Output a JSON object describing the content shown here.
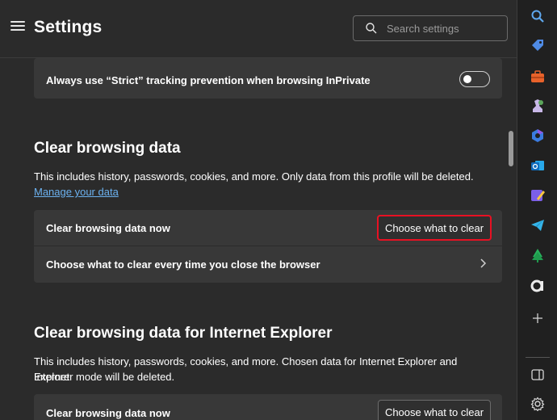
{
  "header": {
    "title": "Settings",
    "search_placeholder": "Search settings"
  },
  "tracking": {
    "label": "Always use “Strict” tracking prevention when browsing InPrivate",
    "toggle_on": false
  },
  "clear_section": {
    "title": "Clear browsing data",
    "description": "This includes history, passwords, cookies, and more. Only data from this profile will be deleted.",
    "manage_link": "Manage your data",
    "row_now_label": "Clear browsing data now",
    "row_now_button": "Choose what to clear",
    "row_close_label": "Choose what to clear every time you close the browser"
  },
  "ie_section": {
    "title": "Clear browsing data for Internet Explorer",
    "description_line1": "This includes history, passwords, cookies, and more. Chosen data for Internet Explorer and Internet",
    "description_line2": "Explorer mode will be deleted.",
    "row_now_label": "Clear browsing data now",
    "row_now_button": "Choose what to clear"
  },
  "sidebar": {
    "icons": [
      "search-icon",
      "shopping-tag-icon",
      "tools-briefcase-icon",
      "games-icon",
      "copilot-icon",
      "outlook-icon",
      "designer-icon",
      "telegram-icon",
      "tree-icon",
      "app-a-icon",
      "add-icon",
      "sidebar-toggle-icon",
      "settings-gear-icon"
    ]
  },
  "colors": {
    "highlight_border": "#e81123",
    "link": "#6cb2f0",
    "card_bg": "#383838",
    "page_bg": "#2b2b2b"
  }
}
